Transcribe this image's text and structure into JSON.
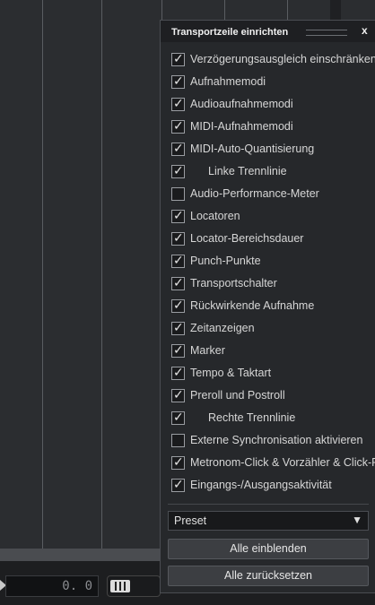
{
  "background": {
    "position_value": "0. 0"
  },
  "panel": {
    "title": "Transportzeile einrichten",
    "close_label": "x",
    "items": [
      {
        "label": "Verzögerungsausgleich einschränken",
        "checked": true,
        "indent": false
      },
      {
        "label": "Aufnahmemodi",
        "checked": true,
        "indent": false
      },
      {
        "label": "Audioaufnahmemodi",
        "checked": true,
        "indent": false
      },
      {
        "label": "MIDI-Aufnahmemodi",
        "checked": true,
        "indent": false
      },
      {
        "label": "MIDI-Auto-Quantisierung",
        "checked": true,
        "indent": false
      },
      {
        "label": "Linke Trennlinie",
        "checked": true,
        "indent": true
      },
      {
        "label": "Audio-Performance-Meter",
        "checked": false,
        "indent": false
      },
      {
        "label": "Locatoren",
        "checked": true,
        "indent": false
      },
      {
        "label": "Locator-Bereichsdauer",
        "checked": true,
        "indent": false
      },
      {
        "label": "Punch-Punkte",
        "checked": true,
        "indent": false
      },
      {
        "label": "Transportschalter",
        "checked": true,
        "indent": false
      },
      {
        "label": "Rückwirkende Aufnahme",
        "checked": true,
        "indent": false
      },
      {
        "label": "Zeitanzeigen",
        "checked": true,
        "indent": false
      },
      {
        "label": "Marker",
        "checked": true,
        "indent": false
      },
      {
        "label": "Tempo & Taktart",
        "checked": true,
        "indent": false
      },
      {
        "label": "Preroll und Postroll",
        "checked": true,
        "indent": false
      },
      {
        "label": "Rechte Trennlinie",
        "checked": true,
        "indent": true
      },
      {
        "label": "Externe Synchronisation aktivieren",
        "checked": false,
        "indent": false
      },
      {
        "label": "Metronom-Click & Vorzähler & Click-Pattern",
        "checked": true,
        "indent": false
      },
      {
        "label": "Eingangs-/Ausgangsaktivität",
        "checked": true,
        "indent": false
      }
    ],
    "preset_label": "Preset",
    "show_all_label": "Alle einblenden",
    "reset_all_label": "Alle zurücksetzen"
  }
}
